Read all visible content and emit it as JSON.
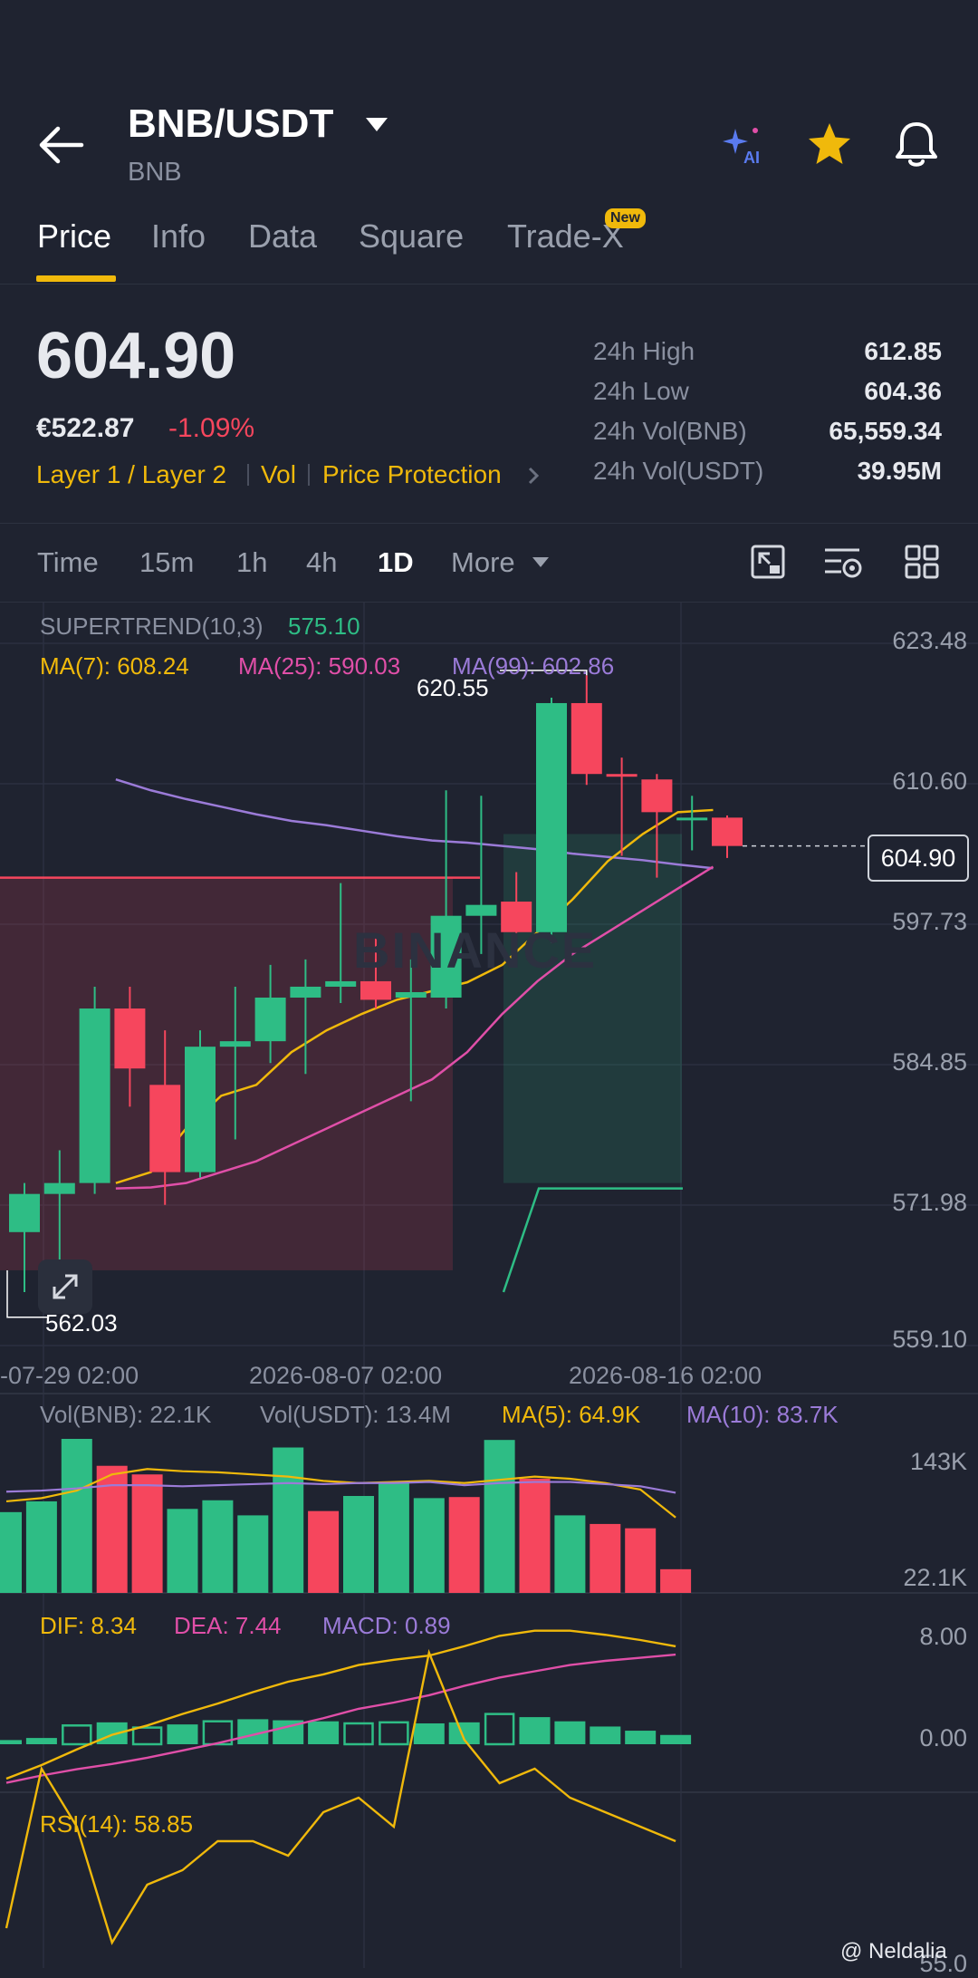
{
  "header": {
    "pair": "BNB/USDT",
    "subtitle": "BNB",
    "ai_badge": "AI",
    "icons": [
      "back-arrow-icon",
      "dropdown-caret-icon",
      "ai-sparkle-icon",
      "star-icon",
      "bell-icon"
    ]
  },
  "tabs": [
    {
      "label": "Price",
      "active": true
    },
    {
      "label": "Info",
      "active": false
    },
    {
      "label": "Data",
      "active": false
    },
    {
      "label": "Square",
      "active": false
    },
    {
      "label": "Trade-X",
      "active": false,
      "badge": "New"
    }
  ],
  "price": {
    "last": "604.90",
    "fiat": "€522.87",
    "change": "-1.09%",
    "tags": [
      "Layer 1 / Layer 2",
      "Vol",
      "Price Protection"
    ],
    "stats": [
      {
        "label": "24h High",
        "value": "612.85"
      },
      {
        "label": "24h Low",
        "value": "604.36"
      },
      {
        "label": "24h Vol(BNB)",
        "value": "65,559.34"
      },
      {
        "label": "24h Vol(USDT)",
        "value": "39.95M"
      }
    ]
  },
  "timeframes": [
    {
      "label": "Time",
      "active": false
    },
    {
      "label": "15m",
      "active": false
    },
    {
      "label": "1h",
      "active": false
    },
    {
      "label": "4h",
      "active": false
    },
    {
      "label": "1D",
      "active": true
    },
    {
      "label": "More",
      "active": false
    }
  ],
  "chart_icons": [
    "fullscreen-icon",
    "indicator-settings-icon",
    "grid-layout-icon"
  ],
  "indicators": {
    "supertrend_label": "SUPERTREND(10,3)",
    "supertrend_value": "575.10",
    "ma7": "MA(7): 608.24",
    "ma25": "MA(25): 590.03",
    "ma99": "MA(99): 602.86",
    "vol_bnb": "Vol(BNB): 22.1K",
    "vol_usdt": "Vol(USDT): 13.4M",
    "vol_ma5": "MA(5): 64.9K",
    "vol_ma10": "MA(10): 83.7K",
    "dif": "DIF: 8.34",
    "dea": "DEA: 7.44",
    "macd": "MACD: 0.89",
    "rsi": "RSI(14): 58.85"
  },
  "watermark": "BINANCE",
  "credit": "@ Neldalia",
  "chart_data": {
    "type": "candlestick",
    "y_ticks": [
      "623.48",
      "610.60",
      "597.73",
      "584.85",
      "571.98",
      "559.10"
    ],
    "ylim": [
      559.1,
      623.48
    ],
    "x_ticks": [
      "-07-29 02:00",
      "2026-08-07 02:00",
      "2026-08-16 02:00"
    ],
    "last_price_label": "604.90",
    "high_marker": "620.55",
    "low_marker": "562.03",
    "colors": {
      "up": "#2ebd85",
      "down": "#f6465d",
      "ma7": "#f0b90b",
      "ma25": "#e04fa8",
      "ma99": "#9b7bd8"
    },
    "candles": [
      {
        "o": 569.5,
        "h": 574.0,
        "l": 564.0,
        "c": 573.0
      },
      {
        "o": 573.0,
        "h": 577.0,
        "l": 565.0,
        "c": 574.0
      },
      {
        "o": 574.0,
        "h": 592.0,
        "l": 573.0,
        "c": 590.0
      },
      {
        "o": 590.0,
        "h": 592.0,
        "l": 581.0,
        "c": 584.5
      },
      {
        "o": 583.0,
        "h": 588.0,
        "l": 572.0,
        "c": 575.0
      },
      {
        "o": 575.0,
        "h": 588.0,
        "l": 574.5,
        "c": 586.5
      },
      {
        "o": 586.5,
        "h": 592.0,
        "l": 578.0,
        "c": 587.0
      },
      {
        "o": 587.0,
        "h": 594.0,
        "l": 585.0,
        "c": 591.0
      },
      {
        "o": 591.0,
        "h": 594.5,
        "l": 584.0,
        "c": 592.0
      },
      {
        "o": 592.0,
        "h": 601.5,
        "l": 590.5,
        "c": 592.5
      },
      {
        "o": 592.5,
        "h": 596.5,
        "l": 590.0,
        "c": 590.8
      },
      {
        "o": 591.0,
        "h": 594.5,
        "l": 581.5,
        "c": 591.5
      },
      {
        "o": 591.0,
        "h": 610.0,
        "l": 590.0,
        "c": 598.5
      },
      {
        "o": 598.5,
        "h": 609.5,
        "l": 595.0,
        "c": 599.5
      },
      {
        "o": 599.8,
        "h": 602.5,
        "l": 596.0,
        "c": 597.0
      },
      {
        "o": 597.0,
        "h": 618.5,
        "l": 596.0,
        "c": 618.0
      },
      {
        "o": 618.0,
        "h": 620.55,
        "l": 610.5,
        "c": 611.5
      },
      {
        "o": 611.5,
        "h": 613.0,
        "l": 604.0,
        "c": 611.3
      },
      {
        "o": 611.0,
        "h": 611.5,
        "l": 602.0,
        "c": 608.0
      },
      {
        "o": 607.5,
        "h": 609.5,
        "l": 604.5,
        "c": 607.5
      },
      {
        "o": 607.5,
        "h": 607.7,
        "l": 603.8,
        "c": 604.9
      }
    ],
    "ma7": [
      574,
      575,
      579,
      582,
      583,
      586,
      588,
      589.5,
      590.8,
      591.6,
      592.4,
      594,
      597,
      600,
      603.5,
      606,
      608,
      608.2
    ],
    "ma25": [
      573.5,
      573.6,
      574,
      575,
      576,
      577.5,
      579,
      580.5,
      582,
      583.5,
      586,
      589.5,
      592.5,
      595,
      597,
      599,
      601,
      603
    ],
    "ma99": [
      611,
      610,
      609.2,
      608.5,
      607.8,
      607.2,
      606.8,
      606.3,
      605.8,
      605.4,
      605.2,
      604.9,
      604.6,
      604.2,
      603.9,
      603.6,
      603.2,
      602.86
    ],
    "supertrend": [
      564,
      573.5,
      573.5,
      573.5,
      573.5
    ],
    "volume": {
      "ylim": [
        0,
        143
      ],
      "ticks": [
        "143K",
        "22.1K"
      ],
      "values": [
        75,
        85,
        143,
        118,
        110,
        78,
        86,
        72,
        135,
        76,
        90,
        102,
        88,
        89,
        142,
        106,
        72,
        64,
        60,
        22
      ]
    },
    "macd": {
      "ticks": [
        "8.00",
        "0.00"
      ],
      "hist": [
        0.4,
        0.6,
        1.8,
        2.1,
        1.6,
        1.9,
        2.2,
        2.4,
        2.3,
        2.2,
        2.0,
        2.1,
        2.0,
        2.1,
        2.9,
        2.6,
        2.2,
        1.7,
        1.3,
        0.89
      ],
      "dif": [
        -3.3,
        -2.0,
        -0.5,
        0.9,
        1.8,
        2.9,
        3.9,
        5.0,
        6.0,
        6.7,
        7.6,
        8.1,
        8.5,
        9.4,
        10.4,
        10.9,
        10.9,
        10.5,
        10.0,
        9.4
      ],
      "dea": [
        -3.7,
        -3.0,
        -2.4,
        -1.9,
        -1.3,
        -0.6,
        0.1,
        0.9,
        1.7,
        2.5,
        3.4,
        4.0,
        4.7,
        5.6,
        6.4,
        7.0,
        7.6,
        8.0,
        8.3,
        8.6
      ]
    },
    "rsi": {
      "ticks": [
        "55.0"
      ],
      "values": [
        47,
        58,
        54,
        46,
        50,
        51,
        53,
        53,
        52,
        55,
        56,
        54,
        66,
        60,
        57,
        58,
        56,
        55,
        54,
        53
      ]
    }
  }
}
